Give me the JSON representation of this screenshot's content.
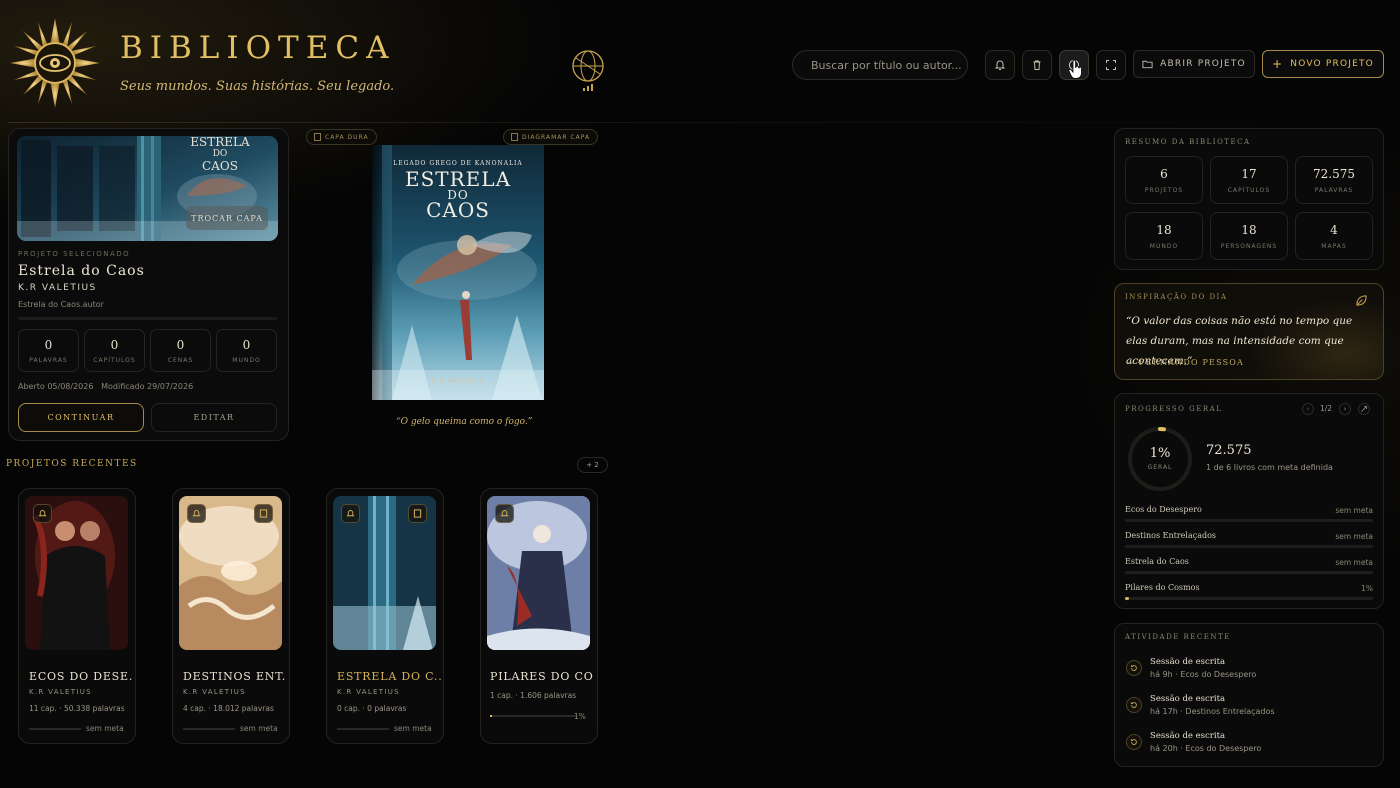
{
  "brand": {
    "title": "BIBLIOTECA",
    "subtitle": "Seus mundos. Suas histórias. Seu legado."
  },
  "search": {
    "placeholder": "Buscar por título ou autor..."
  },
  "toolbar": {
    "open_label": "ABRIR PROJETO",
    "new_label": "NOVO PROJETO"
  },
  "selected": {
    "section_label": "PROJETO SELECIONADO",
    "title": "Estrela do Caos",
    "author": "K.R VALETIUS",
    "meta": "Estrela do Caos.autor",
    "swap_cover": "TROCAR CAPA",
    "stats": [
      {
        "value": "0",
        "label": "PALAVRAS"
      },
      {
        "value": "0",
        "label": "CAPÍTULOS"
      },
      {
        "value": "0",
        "label": "CENAS"
      },
      {
        "value": "0",
        "label": "MUNDO"
      }
    ],
    "opened": "Aberto 05/08/2026",
    "modified": "Modificado 29/07/2026",
    "continue_label": "CONTINUAR",
    "edit_label": "EDITAR",
    "cover_title_line1": "ESTRELA",
    "cover_title_line2": "DO",
    "cover_title_line3": "CAOS"
  },
  "preview": {
    "chip_left": "CAPA DURA",
    "chip_right": "DIAGRAMAR CAPA",
    "book_subtitle": "LEGADO GREGO DE KANONALIA",
    "book_title_1": "ESTRELA",
    "book_title_2": "DO",
    "book_title_3": "CAOS",
    "book_author": "K.R VALETIUS",
    "quote": "“O gelo queima como o fogo.”"
  },
  "recent": {
    "title": "PROJETOS RECENTES",
    "more": "+ 2",
    "items": [
      {
        "title": "ECOS DO DESE...",
        "author": "K.R VALETIUS",
        "stats": "11 cap. · 50.338 palavras",
        "meta": "sem meta",
        "highlight": false
      },
      {
        "title": "DESTINOS ENT...",
        "author": "K.R VALETIUS",
        "stats": "4 cap. · 18.012 palavras",
        "meta": "sem meta",
        "highlight": false
      },
      {
        "title": "ESTRELA DO C...",
        "author": "K.R VALETIUS",
        "stats": "0 cap. · 0 palavras",
        "meta": "sem meta",
        "highlight": true
      },
      {
        "title": "PILARES DO CO...",
        "author": "",
        "stats": "1 cap. · 1.606 palavras",
        "meta": "1%",
        "progress": 0.01,
        "highlight": false
      }
    ]
  },
  "summary": {
    "title": "RESUMO DA BIBLIOTECA",
    "stats": [
      {
        "value": "6",
        "label": "PROJETOS"
      },
      {
        "value": "17",
        "label": "CAPÍTULOS"
      },
      {
        "value": "72.575",
        "label": "PALAVRAS"
      },
      {
        "value": "18",
        "label": "MUNDO"
      },
      {
        "value": "18",
        "label": "PERSONAGENS"
      },
      {
        "value": "4",
        "label": "MAPAS"
      }
    ]
  },
  "inspiration": {
    "title": "INSPIRAÇÃO DO DIA",
    "quote": "“O valor das coisas não está no tempo que elas duram, mas na intensidade com que acontecem.”",
    "author": "— FERNANDO PESSOA"
  },
  "progress": {
    "title": "PROGRESSO GERAL",
    "pager": "1/2",
    "ring_value": "1%",
    "ring_label": "GERAL",
    "ring_fraction": 0.01,
    "total": "72.575",
    "note": "1 de 6 livros com meta definida",
    "rows": [
      {
        "name": "Ecos do Desespero",
        "value": "sem meta",
        "fraction": 0
      },
      {
        "name": "Destinos Entrelaçados",
        "value": "sem meta",
        "fraction": 0
      },
      {
        "name": "Estrela do Caos",
        "value": "sem meta",
        "fraction": 0
      },
      {
        "name": "Pilares do Cosmos",
        "value": "1%",
        "fraction": 0.01
      }
    ]
  },
  "activity": {
    "title": "ATIVIDADE RECENTE",
    "items": [
      {
        "title": "Sessão de escrita",
        "time": "há 9h",
        "project": "Ecos do Desespero"
      },
      {
        "title": "Sessão de escrita",
        "time": "há 17h",
        "project": "Destinos Entrelaçados"
      },
      {
        "title": "Sessão de escrita",
        "time": "há 20h",
        "project": "Ecos do Desespero"
      }
    ]
  },
  "colors": {
    "accent": "#d6b15c",
    "background": "#050505",
    "panel": "#0a0a0a",
    "border": "#25231e"
  },
  "icons": [
    "sun-eye-logo-icon",
    "globe-icon",
    "search-icon",
    "bell-icon",
    "trash-icon",
    "info-icon",
    "fullscreen-icon",
    "folder-icon",
    "plus-icon",
    "book-icon",
    "bookmark-icon",
    "leaf-icon",
    "history-icon"
  ]
}
